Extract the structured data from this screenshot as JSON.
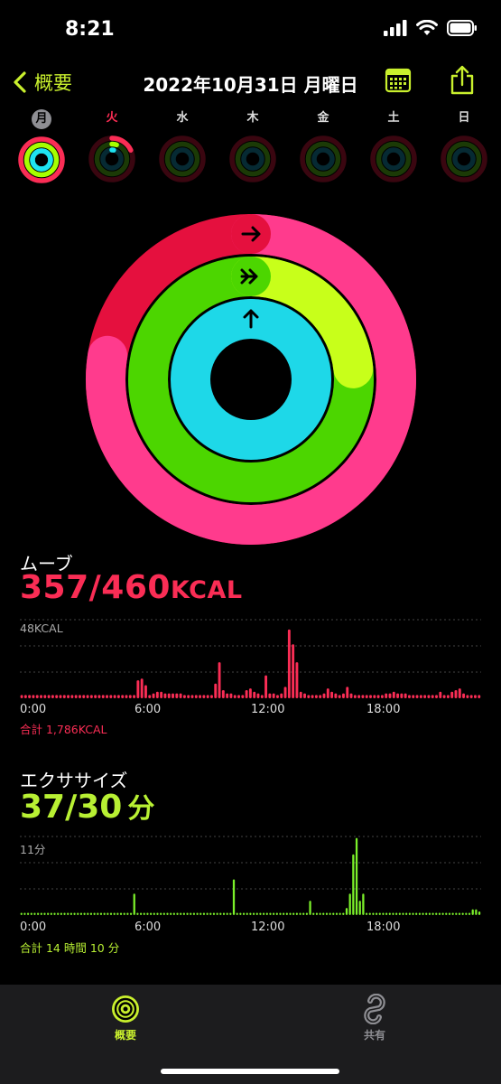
{
  "status": {
    "time": "8:21"
  },
  "nav": {
    "back_label": "概要",
    "title": "2022年10月31日 月曜日"
  },
  "week": [
    {
      "label": "月",
      "today": true
    },
    {
      "label": "火",
      "red": true
    },
    {
      "label": "水"
    },
    {
      "label": "木"
    },
    {
      "label": "金"
    },
    {
      "label": "土"
    },
    {
      "label": "日"
    }
  ],
  "rings": {
    "move_progress": 1.776,
    "exercise_progress": 1.233,
    "stand_progress": 1.0
  },
  "move": {
    "title": "ムーブ",
    "value": "357/460",
    "unit": "KCAL",
    "chart_label": "48KCAL",
    "total": "合計 1,786KCAL",
    "color": "#fa2d55"
  },
  "exercise": {
    "title": "エクササイズ",
    "value": "37/30",
    "unit": "分",
    "chart_label": "11分",
    "total": "合計 14 時間 10 分",
    "color": "#b8f033"
  },
  "time_axis": [
    "0:00",
    "6:00",
    "12:00",
    "18:00"
  ],
  "chart_data": [
    {
      "type": "bar",
      "ylabel": "48KCAL",
      "ylim": [
        0,
        48
      ],
      "categories": [
        "0:00",
        "6:00",
        "12:00",
        "18:00"
      ],
      "series": [
        {
          "values": [
            2,
            2,
            2,
            2,
            2,
            2,
            2,
            2,
            2,
            2,
            2,
            2,
            2,
            2,
            2,
            2,
            2,
            2,
            2,
            2,
            2,
            2,
            2,
            2,
            2,
            2,
            2,
            2,
            2,
            2,
            11,
            12,
            8,
            2,
            3,
            4,
            4,
            3,
            3,
            3,
            3,
            3,
            2,
            2,
            2,
            2,
            2,
            2,
            2,
            2,
            9,
            22,
            5,
            3,
            3,
            2,
            2,
            2,
            5,
            6,
            4,
            3,
            2,
            14,
            3,
            3,
            2,
            3,
            7,
            42,
            33,
            22,
            4,
            3,
            2,
            2,
            2,
            2,
            3,
            6,
            4,
            3,
            2,
            3,
            7,
            3,
            2,
            2,
            2,
            2,
            2,
            2,
            2,
            2,
            3,
            3,
            4,
            3,
            3,
            3,
            2,
            2,
            2,
            2,
            2,
            2,
            2,
            2,
            4,
            2,
            2,
            4,
            5,
            6,
            3,
            2,
            2,
            2,
            2
          ]
        }
      ]
    },
    {
      "type": "bar",
      "ylabel": "11分",
      "ylim": [
        0,
        11
      ],
      "categories": [
        "0:00",
        "6:00",
        "12:00",
        "18:00"
      ],
      "series": [
        {
          "values": [
            0.3,
            0.3,
            0.3,
            0.3,
            0.3,
            0.3,
            0.3,
            0.3,
            0.3,
            0.3,
            0.3,
            0.3,
            0.3,
            0.3,
            0.3,
            0.3,
            0.3,
            0.3,
            0.3,
            0.3,
            0.3,
            0.3,
            0.3,
            0.3,
            0.3,
            0.3,
            0.3,
            0.3,
            0.3,
            0.3,
            0.3,
            0.3,
            0.3,
            0.3,
            3,
            0.3,
            0.3,
            0.3,
            0.3,
            0.3,
            0.3,
            0.3,
            0.3,
            0.3,
            0.3,
            0.3,
            0.3,
            0.3,
            0.3,
            0.3,
            0.3,
            0.3,
            0.3,
            0.3,
            0.3,
            0.3,
            0.3,
            0.3,
            0.3,
            0.3,
            0.3,
            0.3,
            0.3,
            0.3,
            5,
            0.3,
            0.3,
            0.3,
            0.3,
            0.3,
            0.3,
            0.3,
            0.3,
            0.3,
            0.3,
            0.3,
            0.3,
            0.3,
            0.3,
            0.3,
            0.3,
            0.3,
            0.3,
            0.3,
            0.3,
            0.3,
            0.3,
            2,
            0.3,
            0.3,
            0.3,
            0.3,
            0.3,
            0.3,
            0.3,
            0.3,
            0.3,
            0.3,
            1,
            3,
            8.5,
            10.8,
            2,
            3,
            0.3,
            0.3,
            0.3,
            0.3,
            0.3,
            0.3,
            0.3,
            0.3,
            0.3,
            0.3,
            0.3,
            0.3,
            0.3,
            0.3,
            0.3,
            0.3,
            0.3,
            0.3,
            0.3,
            0.3,
            0.3,
            0.3,
            0.3,
            0.3,
            0.3,
            0.3,
            0.3,
            0.3,
            0.3,
            0.3,
            0.3,
            0.3,
            0.8,
            0.8,
            0.5
          ]
        }
      ]
    }
  ],
  "tabs": [
    {
      "label": "概要",
      "active": true
    },
    {
      "label": "共有",
      "active": false
    }
  ]
}
